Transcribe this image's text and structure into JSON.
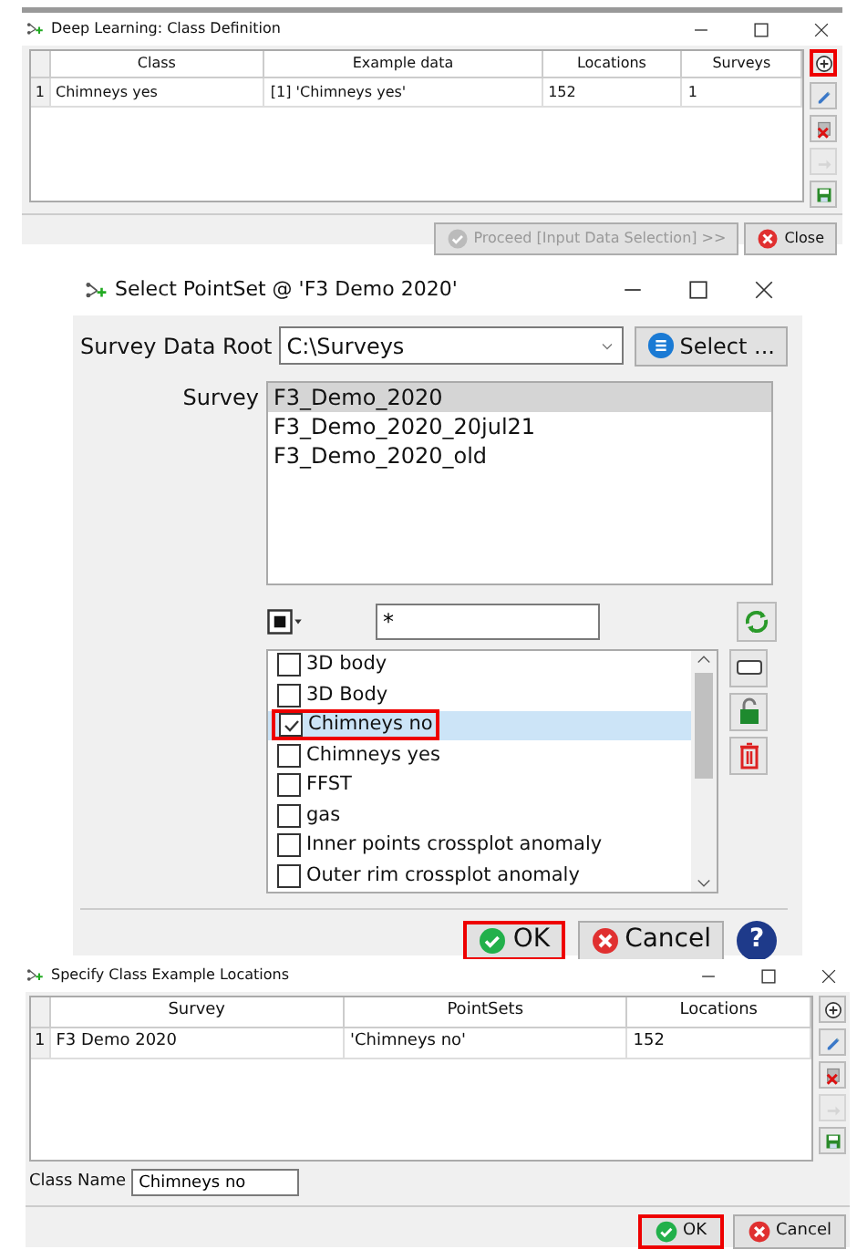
{
  "class_definition": {
    "title": "Deep Learning: Class Definition",
    "columns": [
      "Class",
      "Example data",
      "Locations",
      "Surveys"
    ],
    "rows": [
      {
        "number": "1",
        "cells": [
          "Chimneys yes",
          "[1] 'Chimneys yes'",
          "152",
          "1"
        ]
      }
    ],
    "toolbar": [
      {
        "kind": "add",
        "highlighted": true
      },
      {
        "kind": "edit"
      },
      {
        "kind": "remove"
      },
      {
        "kind": "export",
        "disabled": true
      },
      {
        "kind": "save"
      }
    ],
    "buttons": [
      {
        "kind": "proceed",
        "label": "Proceed [Input Data Selection] >>",
        "disabled": true
      },
      {
        "kind": "close",
        "label": "Close"
      }
    ]
  },
  "select_pointset": {
    "title": "Select PointSet @ 'F3 Demo 2020'",
    "data_root_label": "Survey Data Root",
    "data_root_value": "C:\\Surveys",
    "select_button": "Select ...",
    "survey_label": "Survey",
    "surveys": [
      {
        "label": "F3_Demo_2020",
        "selected": true
      },
      {
        "label": "F3_Demo_2020_20jul21",
        "selected": false
      },
      {
        "label": "F3_Demo_2020_old",
        "selected": false
      }
    ],
    "filter": "*",
    "pointsets": [
      {
        "label": "3D body",
        "checked": false,
        "selected": false,
        "highlighted": false
      },
      {
        "label": "3D Body",
        "checked": false,
        "selected": false,
        "highlighted": false
      },
      {
        "label": "Chimneys no",
        "checked": true,
        "selected": true,
        "highlighted": true
      },
      {
        "label": "Chimneys yes",
        "checked": false,
        "selected": false,
        "highlighted": false
      },
      {
        "label": "FFST",
        "checked": false,
        "selected": false,
        "highlighted": false
      },
      {
        "label": "gas",
        "checked": false,
        "selected": false,
        "highlighted": false
      },
      {
        "label": "Inner points crossplot anomaly",
        "checked": false,
        "selected": false,
        "highlighted": false
      },
      {
        "label": "Outer rim crossplot anomaly",
        "checked": false,
        "selected": false,
        "highlighted": false
      }
    ],
    "side_tools": [
      {
        "kind": "rectangle"
      },
      {
        "kind": "unlock"
      },
      {
        "kind": "delete"
      }
    ],
    "buttons": [
      {
        "kind": "ok",
        "label": "OK",
        "highlighted": true
      },
      {
        "kind": "cancel",
        "label": "Cancel"
      },
      {
        "kind": "help",
        "label": "?"
      }
    ]
  },
  "class_locations": {
    "title": "Specify Class Example Locations",
    "columns": [
      "Survey",
      "PointSets",
      "Locations"
    ],
    "rows": [
      {
        "number": "1",
        "cells": [
          "F3 Demo 2020",
          "'Chimneys no'",
          "152"
        ]
      }
    ],
    "toolbar": [
      {
        "kind": "add"
      },
      {
        "kind": "edit"
      },
      {
        "kind": "remove"
      },
      {
        "kind": "export",
        "disabled": true
      },
      {
        "kind": "save"
      }
    ],
    "class_name_label": "Class Name",
    "class_name_value": "Chimneys no",
    "buttons": [
      {
        "kind": "ok",
        "label": "OK",
        "highlighted": true
      },
      {
        "kind": "cancel",
        "label": "Cancel"
      }
    ]
  }
}
